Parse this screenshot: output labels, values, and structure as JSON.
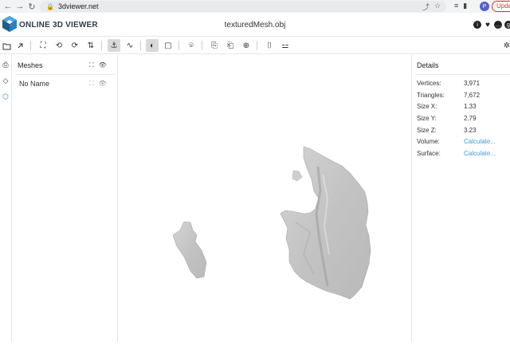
{
  "browser": {
    "url": "3dviewer.net",
    "update_label": "Upda",
    "profile_initial": "P"
  },
  "app": {
    "logo_text": "ONLINE 3D VIEWER",
    "file_title": "texturedMesh.obj"
  },
  "meshes_panel": {
    "title": "Meshes",
    "items": [
      {
        "name": "No Name"
      }
    ]
  },
  "details_panel": {
    "title": "Details",
    "rows": [
      {
        "key": "Vertices:",
        "value": "3,971"
      },
      {
        "key": "Triangles:",
        "value": "7,672"
      },
      {
        "key": "Size X:",
        "value": "1.33"
      },
      {
        "key": "Size Y:",
        "value": "2.79"
      },
      {
        "key": "Size Z:",
        "value": "3.23"
      },
      {
        "key": "Volume:",
        "value": "Calculate..."
      },
      {
        "key": "Surface:",
        "value": "Calculate..."
      }
    ]
  },
  "colors": {
    "accent": "#1a8fd6",
    "link": "#3a9fd8",
    "mesh_fill": "#c9c9c9"
  }
}
